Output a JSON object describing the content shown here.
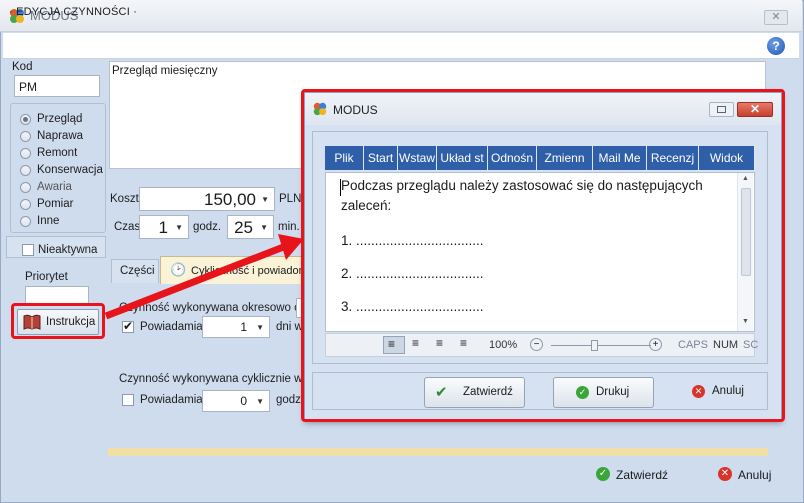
{
  "app": {
    "title": "MODUS"
  },
  "header": {
    "section_title": "· EDYCJA CZYNNOŚCI ·",
    "help_label": "?"
  },
  "form": {
    "kod_label": "Kod",
    "kod_value": "PM",
    "description": "Przegląd miesięczny",
    "types": [
      "Przegląd",
      "Naprawa",
      "Remont",
      "Konserwacja",
      "Awaria",
      "Pomiar",
      "Inne"
    ],
    "selected_type": "Przegląd",
    "inactive_label": "Nieaktywna",
    "priority_label": "Priorytet",
    "instruction_button": "Instrukcja",
    "cost_label": "Koszt",
    "cost_value": "150,00",
    "currency": "PLN",
    "time_label": "Czas",
    "hours_value": "1",
    "hours_unit": "godz.",
    "minutes_value": "25",
    "minutes_unit": "min.",
    "tabs": [
      "Części",
      "Cykliczność i powiadom"
    ],
    "periodic_label": "Czynność wykonywana okresowo co",
    "notify_label": "Powiadamiaj",
    "notify1_value": "1",
    "notify1_unit": "dni w",
    "notify1_checked": true,
    "cyclic_label": "Czynność wykonywana cyklicznie wg s",
    "notify2_value": "0",
    "notify2_unit": "godz.",
    "notify2_checked": false
  },
  "footer": {
    "confirm": "Zatwierdź",
    "cancel": "Anuluj"
  },
  "dialog": {
    "title": "MODUS",
    "menu": [
      "Plik",
      "Start",
      "Wstaw",
      "Układ st",
      "Odnośn",
      "Zmienn",
      "Mail Me",
      "Recenzj",
      "Widok"
    ],
    "editor_lines": [
      "Podczas przeglądu należy zastosować się do następujących",
      "zaleceń:",
      "1.  ..................................",
      "2.  ..................................",
      "3.  .................................."
    ],
    "zoom": "100%",
    "status_caps": "CAPS",
    "status_num": "NUM",
    "status_scr": "SC",
    "confirm": "Zatwierdź",
    "print": "Drukuj",
    "cancel": "Anuluj"
  },
  "colors": {
    "highlight": "#e8141c",
    "menu_bg": "#2f5fa8",
    "window_bg": "#cfdcee"
  }
}
